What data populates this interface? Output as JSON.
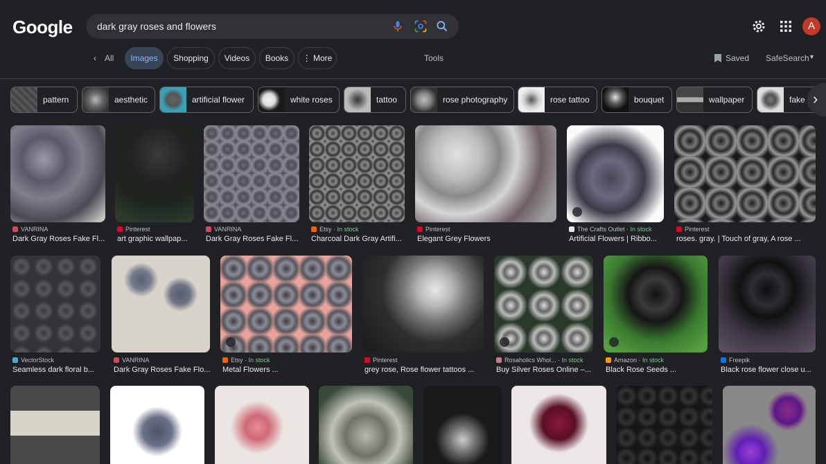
{
  "header": {
    "logo_text": "Google",
    "query": "dark gray roses and flowers",
    "avatar_letter": "A"
  },
  "nav": {
    "back_all": "All",
    "tabs": [
      "Images",
      "Shopping",
      "Videos",
      "Books",
      "More"
    ],
    "tools": "Tools",
    "saved": "Saved",
    "safesearch": "SafeSearch"
  },
  "chips": [
    "pattern",
    "aesthetic",
    "artificial flower",
    "white roses",
    "tattoo",
    "rose photography",
    "rose tattoo",
    "bouquet",
    "wallpaper",
    "fake f"
  ],
  "results": [
    {
      "source": "VANRINA",
      "stock": "",
      "title": "Dark Gray Roses Fake Fl..."
    },
    {
      "source": "Pinterest",
      "stock": "",
      "title": "art graphic wallpap..."
    },
    {
      "source": "VANRINA",
      "stock": "",
      "title": "Dark Gray Roses Fake Fl..."
    },
    {
      "source": "Etsy ·",
      "stock": "In stock",
      "title": "Charcoal Dark Gray Artifi..."
    },
    {
      "source": "Pinterest",
      "stock": "",
      "title": "Elegant Grey Flowers"
    },
    {
      "source": "The Crafts Outlet ·",
      "stock": "In stock",
      "title": "Artificial Flowers | Ribbo..."
    },
    {
      "source": "Pinterest",
      "stock": "",
      "title": "roses. gray. | Touch of gray, A rose ..."
    },
    {
      "source": "VectorStock",
      "stock": "",
      "title": "Seamless dark floral b..."
    },
    {
      "source": "VANRINA",
      "stock": "",
      "title": "Dark Gray Roses Fake Flo..."
    },
    {
      "source": "Etsy ·",
      "stock": "In stock",
      "title": "Metal Flowers ..."
    },
    {
      "source": "Pinterest",
      "stock": "",
      "title": "grey rose, Rose flower tattoos ..."
    },
    {
      "source": "Rosaholics Whol... ·",
      "stock": "In stock",
      "title": "Buy Silver Roses Online –..."
    },
    {
      "source": "Amazon ·",
      "stock": "In stock",
      "title": "Black Rose Seeds ..."
    },
    {
      "source": "Freepik",
      "stock": "",
      "title": "Black rose flower close u..."
    },
    {
      "source": "",
      "stock": "",
      "title": ""
    },
    {
      "source": "",
      "stock": "",
      "title": ""
    },
    {
      "source": "",
      "stock": "",
      "title": ""
    },
    {
      "source": "",
      "stock": "",
      "title": ""
    },
    {
      "source": "",
      "stock": "",
      "title": ""
    },
    {
      "source": "",
      "stock": "",
      "title": ""
    },
    {
      "source": "",
      "stock": "",
      "title": ""
    },
    {
      "source": "",
      "stock": "",
      "title": ""
    }
  ],
  "icons": {
    "mic": "mic-icon",
    "lens": "lens-icon",
    "search": "search-icon",
    "settings": "gear-icon",
    "apps": "apps-grid-icon",
    "bookmark": "bookmark-icon",
    "chevron": "chevron-down-icon",
    "next": "chevron-right-icon"
  },
  "colors": {
    "background": "#202124",
    "active_tab_bg": "#394457",
    "active_tab_text": "#8ab4f8",
    "in_stock": "#81c995",
    "avatar": "#c0392b"
  }
}
